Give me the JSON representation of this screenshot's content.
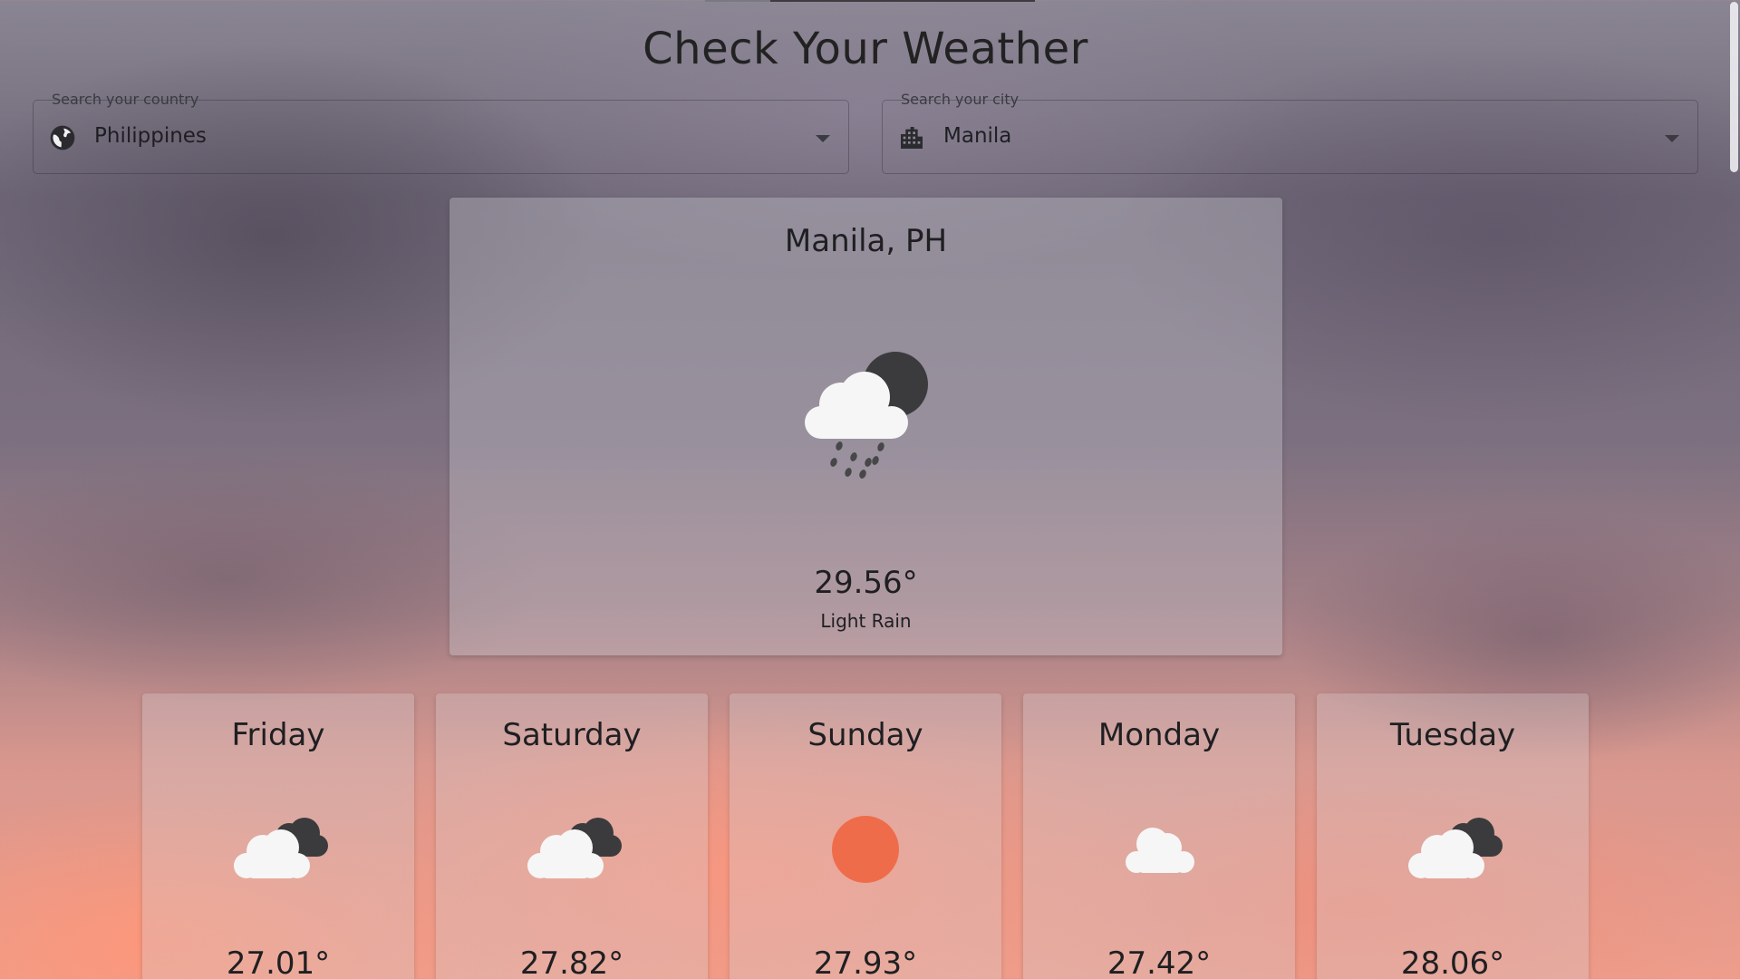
{
  "page": {
    "title": "Check Your Weather"
  },
  "search": {
    "country": {
      "label": "Search your country",
      "value": "Philippines",
      "icon": "globe-icon"
    },
    "city": {
      "label": "Search your city",
      "value": "Manila",
      "icon": "city-icon"
    }
  },
  "current": {
    "location": "Manila, PH",
    "temperature": "29.56°",
    "description": "Light Rain",
    "icon": "cloud-rain-night-icon"
  },
  "forecast": [
    {
      "day": "Friday",
      "temperature": "27.01°",
      "icon": "broken-clouds-icon"
    },
    {
      "day": "Saturday",
      "temperature": "27.82°",
      "icon": "broken-clouds-icon"
    },
    {
      "day": "Sunday",
      "temperature": "27.93°",
      "icon": "sun-icon"
    },
    {
      "day": "Monday",
      "temperature": "27.42°",
      "icon": "cloud-icon"
    },
    {
      "day": "Tuesday",
      "temperature": "28.06°",
      "icon": "broken-clouds-icon"
    }
  ],
  "colors": {
    "sun": "#ef6c4a",
    "cloud": "#f6f6f6",
    "dark_cloud": "#3c3c3e"
  }
}
